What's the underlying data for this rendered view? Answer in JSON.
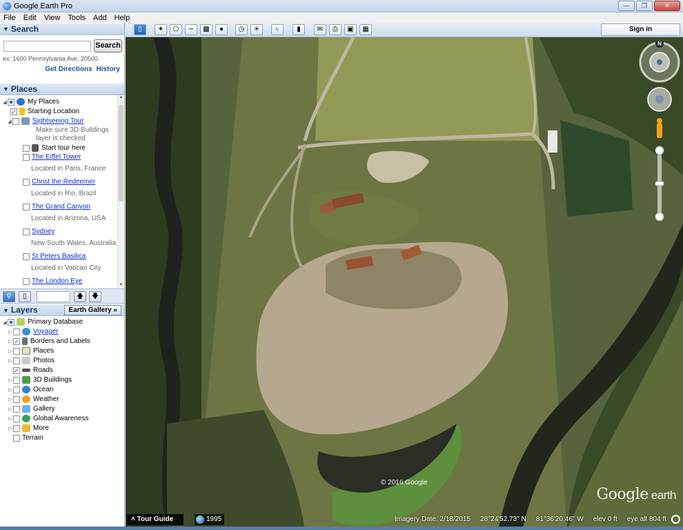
{
  "window": {
    "title": "Google Earth Pro"
  },
  "menu": [
    "File",
    "Edit",
    "View",
    "Tools",
    "Add",
    "Help"
  ],
  "search": {
    "header": "Search",
    "button": "Search",
    "placeholder": "",
    "hint": "ex: 1600 Pennsylvania Ave, 20500",
    "get_directions": "Get Directions",
    "history": "History"
  },
  "places": {
    "header": "Places",
    "items": [
      {
        "label": "My Places"
      },
      {
        "label": "Starting Location"
      },
      {
        "label": "Sightseeing Tour"
      },
      {
        "label": "Make sure 3D Buildings"
      },
      {
        "label": "layer is checked"
      },
      {
        "label": "Start tour here"
      },
      {
        "label": "The Eiffel Tower"
      },
      {
        "label": "Located in Paris, France"
      },
      {
        "label": "Christ the Redeemer"
      },
      {
        "label": "Located in Rio, Brazil"
      },
      {
        "label": "The Grand Canyon"
      },
      {
        "label": "Located in Arizona, USA"
      },
      {
        "label": "Sydney"
      },
      {
        "label": "New South Wales, Australia"
      },
      {
        "label": "St Peters Basilica"
      },
      {
        "label": "Located in Vatican City"
      },
      {
        "label": "The London Eye"
      }
    ]
  },
  "layers": {
    "header": "Layers",
    "gallery_button": "Earth Gallery »",
    "items": [
      {
        "label": "Primary Database"
      },
      {
        "label": "Voyager"
      },
      {
        "label": "Borders and Labels"
      },
      {
        "label": "Places"
      },
      {
        "label": "Photos"
      },
      {
        "label": "Roads"
      },
      {
        "label": "3D Buildings"
      },
      {
        "label": "Ocean"
      },
      {
        "label": "Weather"
      },
      {
        "label": "Gallery"
      },
      {
        "label": "Global Awareness"
      },
      {
        "label": "More"
      },
      {
        "label": "Terrain"
      }
    ]
  },
  "toolbar": {
    "sign_in": "Sign in"
  },
  "map": {
    "copyright": "© 2016 Google",
    "logo_main": "Google",
    "logo_sub": "earth",
    "tour_guide": "˄ Tour Guide",
    "year": "1995",
    "imagery_date": "Imagery Date: 2/18/2015",
    "latitude": "28°24'52.73\" N",
    "longitude": "81°36'20.46\" W",
    "elev": "elev    0 ft",
    "eye_alt": "eye alt   804 ft",
    "compass_north": "N"
  },
  "colors": {
    "field": "#8f9355",
    "dirt": "#b3a58e",
    "forest": "#33401f",
    "water": "#2a2e24"
  }
}
